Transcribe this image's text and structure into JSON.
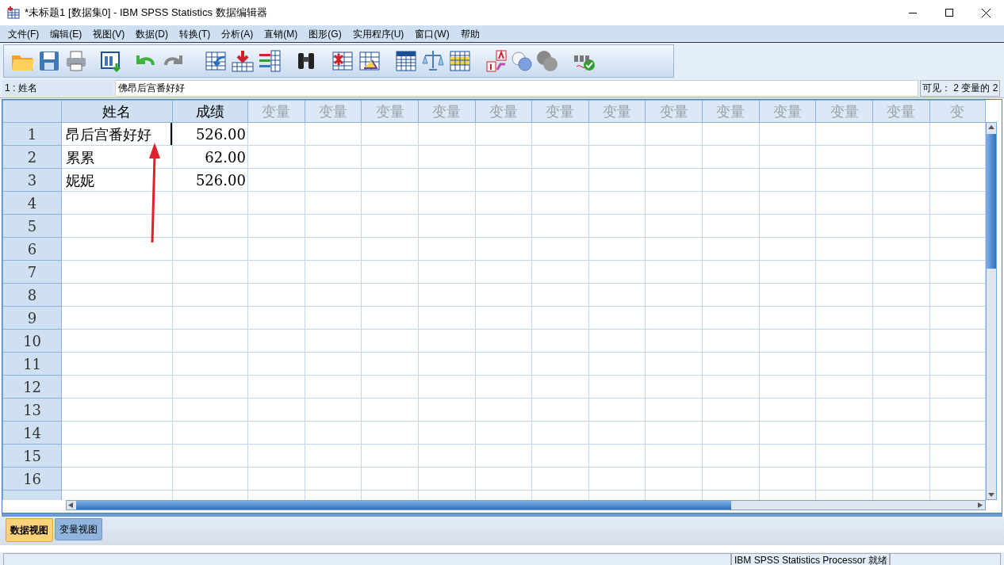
{
  "window": {
    "title": "*未标题1 [数据集0] - IBM SPSS Statistics 数据编辑器"
  },
  "menu": [
    "文件(F)",
    "编辑(E)",
    "视图(V)",
    "数据(D)",
    "转换(T)",
    "分析(A)",
    "直销(M)",
    "图形(G)",
    "实用程序(U)",
    "窗口(W)",
    "帮助"
  ],
  "cell_editor": {
    "cell_ref": "1 : 姓名",
    "value": "佛昂后宫番好好",
    "visible": "可见： 2 变量的 2"
  },
  "table": {
    "columns": [
      {
        "label": "姓名",
        "defined": true
      },
      {
        "label": "成绩",
        "defined": true
      },
      {
        "label": "变量",
        "defined": false
      },
      {
        "label": "变量",
        "defined": false
      },
      {
        "label": "变量",
        "defined": false
      },
      {
        "label": "变量",
        "defined": false
      },
      {
        "label": "变量",
        "defined": false
      },
      {
        "label": "变量",
        "defined": false
      },
      {
        "label": "变量",
        "defined": false
      },
      {
        "label": "变量",
        "defined": false
      },
      {
        "label": "变量",
        "defined": false
      },
      {
        "label": "变量",
        "defined": false
      },
      {
        "label": "变量",
        "defined": false
      },
      {
        "label": "变量",
        "defined": false
      },
      {
        "label": "变",
        "defined": false
      }
    ],
    "rows": [
      {
        "number": "1",
        "cells": [
          "昂后宫番好好",
          "526.00"
        ],
        "editing": true
      },
      {
        "number": "2",
        "cells": [
          "累累",
          "62.00"
        ],
        "editing": false
      },
      {
        "number": "3",
        "cells": [
          "妮妮",
          "526.00"
        ],
        "editing": false
      },
      {
        "number": "4",
        "cells": [],
        "editing": false
      },
      {
        "number": "5",
        "cells": [],
        "editing": false
      },
      {
        "number": "6",
        "cells": [],
        "editing": false
      },
      {
        "number": "7",
        "cells": [],
        "editing": false
      },
      {
        "number": "8",
        "cells": [],
        "editing": false
      },
      {
        "number": "9",
        "cells": [],
        "editing": false
      },
      {
        "number": "10",
        "cells": [],
        "editing": false
      },
      {
        "number": "11",
        "cells": [],
        "editing": false
      },
      {
        "number": "12",
        "cells": [],
        "editing": false
      },
      {
        "number": "13",
        "cells": [],
        "editing": false
      },
      {
        "number": "14",
        "cells": [],
        "editing": false
      },
      {
        "number": "15",
        "cells": [],
        "editing": false
      },
      {
        "number": "16",
        "cells": [],
        "editing": false
      }
    ]
  },
  "view_tabs": [
    {
      "label": "数据视图",
      "selected": true
    },
    {
      "label": "变量视图",
      "selected": false
    }
  ],
  "status_bar": "IBM SPSS Statistics Processor 就绪"
}
